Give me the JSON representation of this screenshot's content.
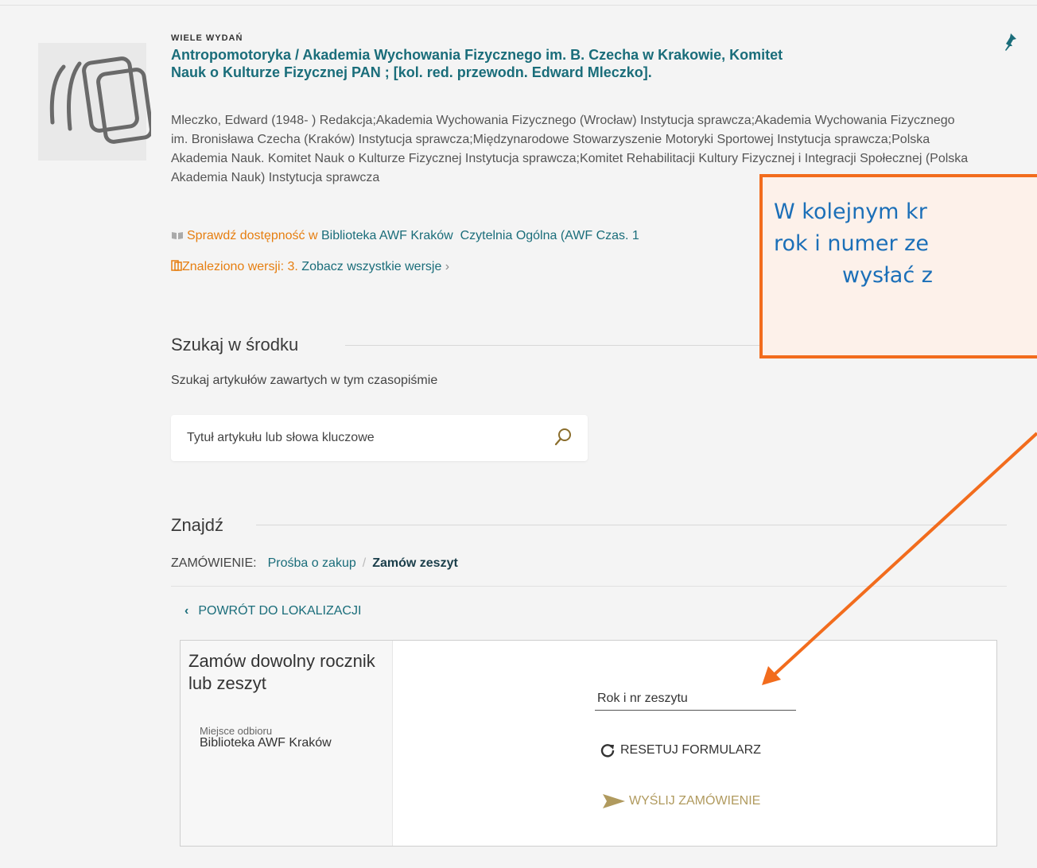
{
  "record": {
    "edition_label": "WIELE WYDAŃ",
    "title": "Antropomotoryka / Akademia Wychowania Fizycznego im. B. Czecha w Krakowie, Komitet Nauk o Kulturze Fizycznej PAN ; [kol. red. przewodn. Edward Mleczko].",
    "authors": "Mleczko, Edward (1948- ) Redakcja;Akademia Wychowania Fizycznego (Wrocław) Instytucja sprawcza;Akademia Wychowania Fizycznego im. Bronisława Czecha (Kraków) Instytucja sprawcza;Międzynarodowe Stowarzyszenie Motoryki Sportowej Instytucja sprawcza;Polska Akademia Nauk. Komitet Nauk o Kulturze Fizycznej Instytucja sprawcza;Komitet Rehabilitacji Kultury Fizycznej i Integracji Społecznej (Polska Akademia Nauk) Instytucja sprawcza",
    "availability_prefix": "Sprawdź dostępność w",
    "availability_library": "Biblioteka AWF Kraków",
    "availability_location": "Czytelnia Ogólna (AWF Czas. 1",
    "versions_found": "Znaleziono wersji: 3.",
    "versions_link": "Zobacz wszystkie wersje",
    "versions_chevron": "›"
  },
  "search_inside": {
    "heading": "Szukaj w środku",
    "description": "Szukaj artykułów zawartych w tym czasopiśmie",
    "placeholder": "Tytuł artykułu lub słowa kluczowe"
  },
  "find": {
    "heading": "Znajdź",
    "order_label": "ZAMÓWIENIE:",
    "purchase_request": "Prośba o zakup",
    "separator": "/",
    "order_issue": "Zamów zeszyt",
    "back_chevron": "‹",
    "back_label": "POWRÓT DO LOKALIZACJI"
  },
  "form": {
    "title": "Zamów dowolny rocznik lub zeszyt",
    "pickup_label": "Miejsce odbioru",
    "pickup_value": "Biblioteka AWF Kraków",
    "field_placeholder": "Rok i nr zeszytu",
    "reset_label": "RESETUJ FORMULARZ",
    "send_label": "WYŚLIJ ZAMÓWIENIE"
  },
  "annotation": {
    "line1": "W kolejnym kr",
    "line2": "rok i numer ze",
    "line3": "wysłać z",
    "border_color": "#f26c1d",
    "text_color": "#1b6fb8"
  },
  "colors": {
    "link": "#1a6d7a",
    "accent_orange": "#e67e10",
    "send_gold": "#b09a5e"
  },
  "icons": [
    "multi-edition-icon",
    "pin-icon",
    "book-icon",
    "versions-icon",
    "search-icon",
    "reset-icon",
    "send-icon"
  ]
}
